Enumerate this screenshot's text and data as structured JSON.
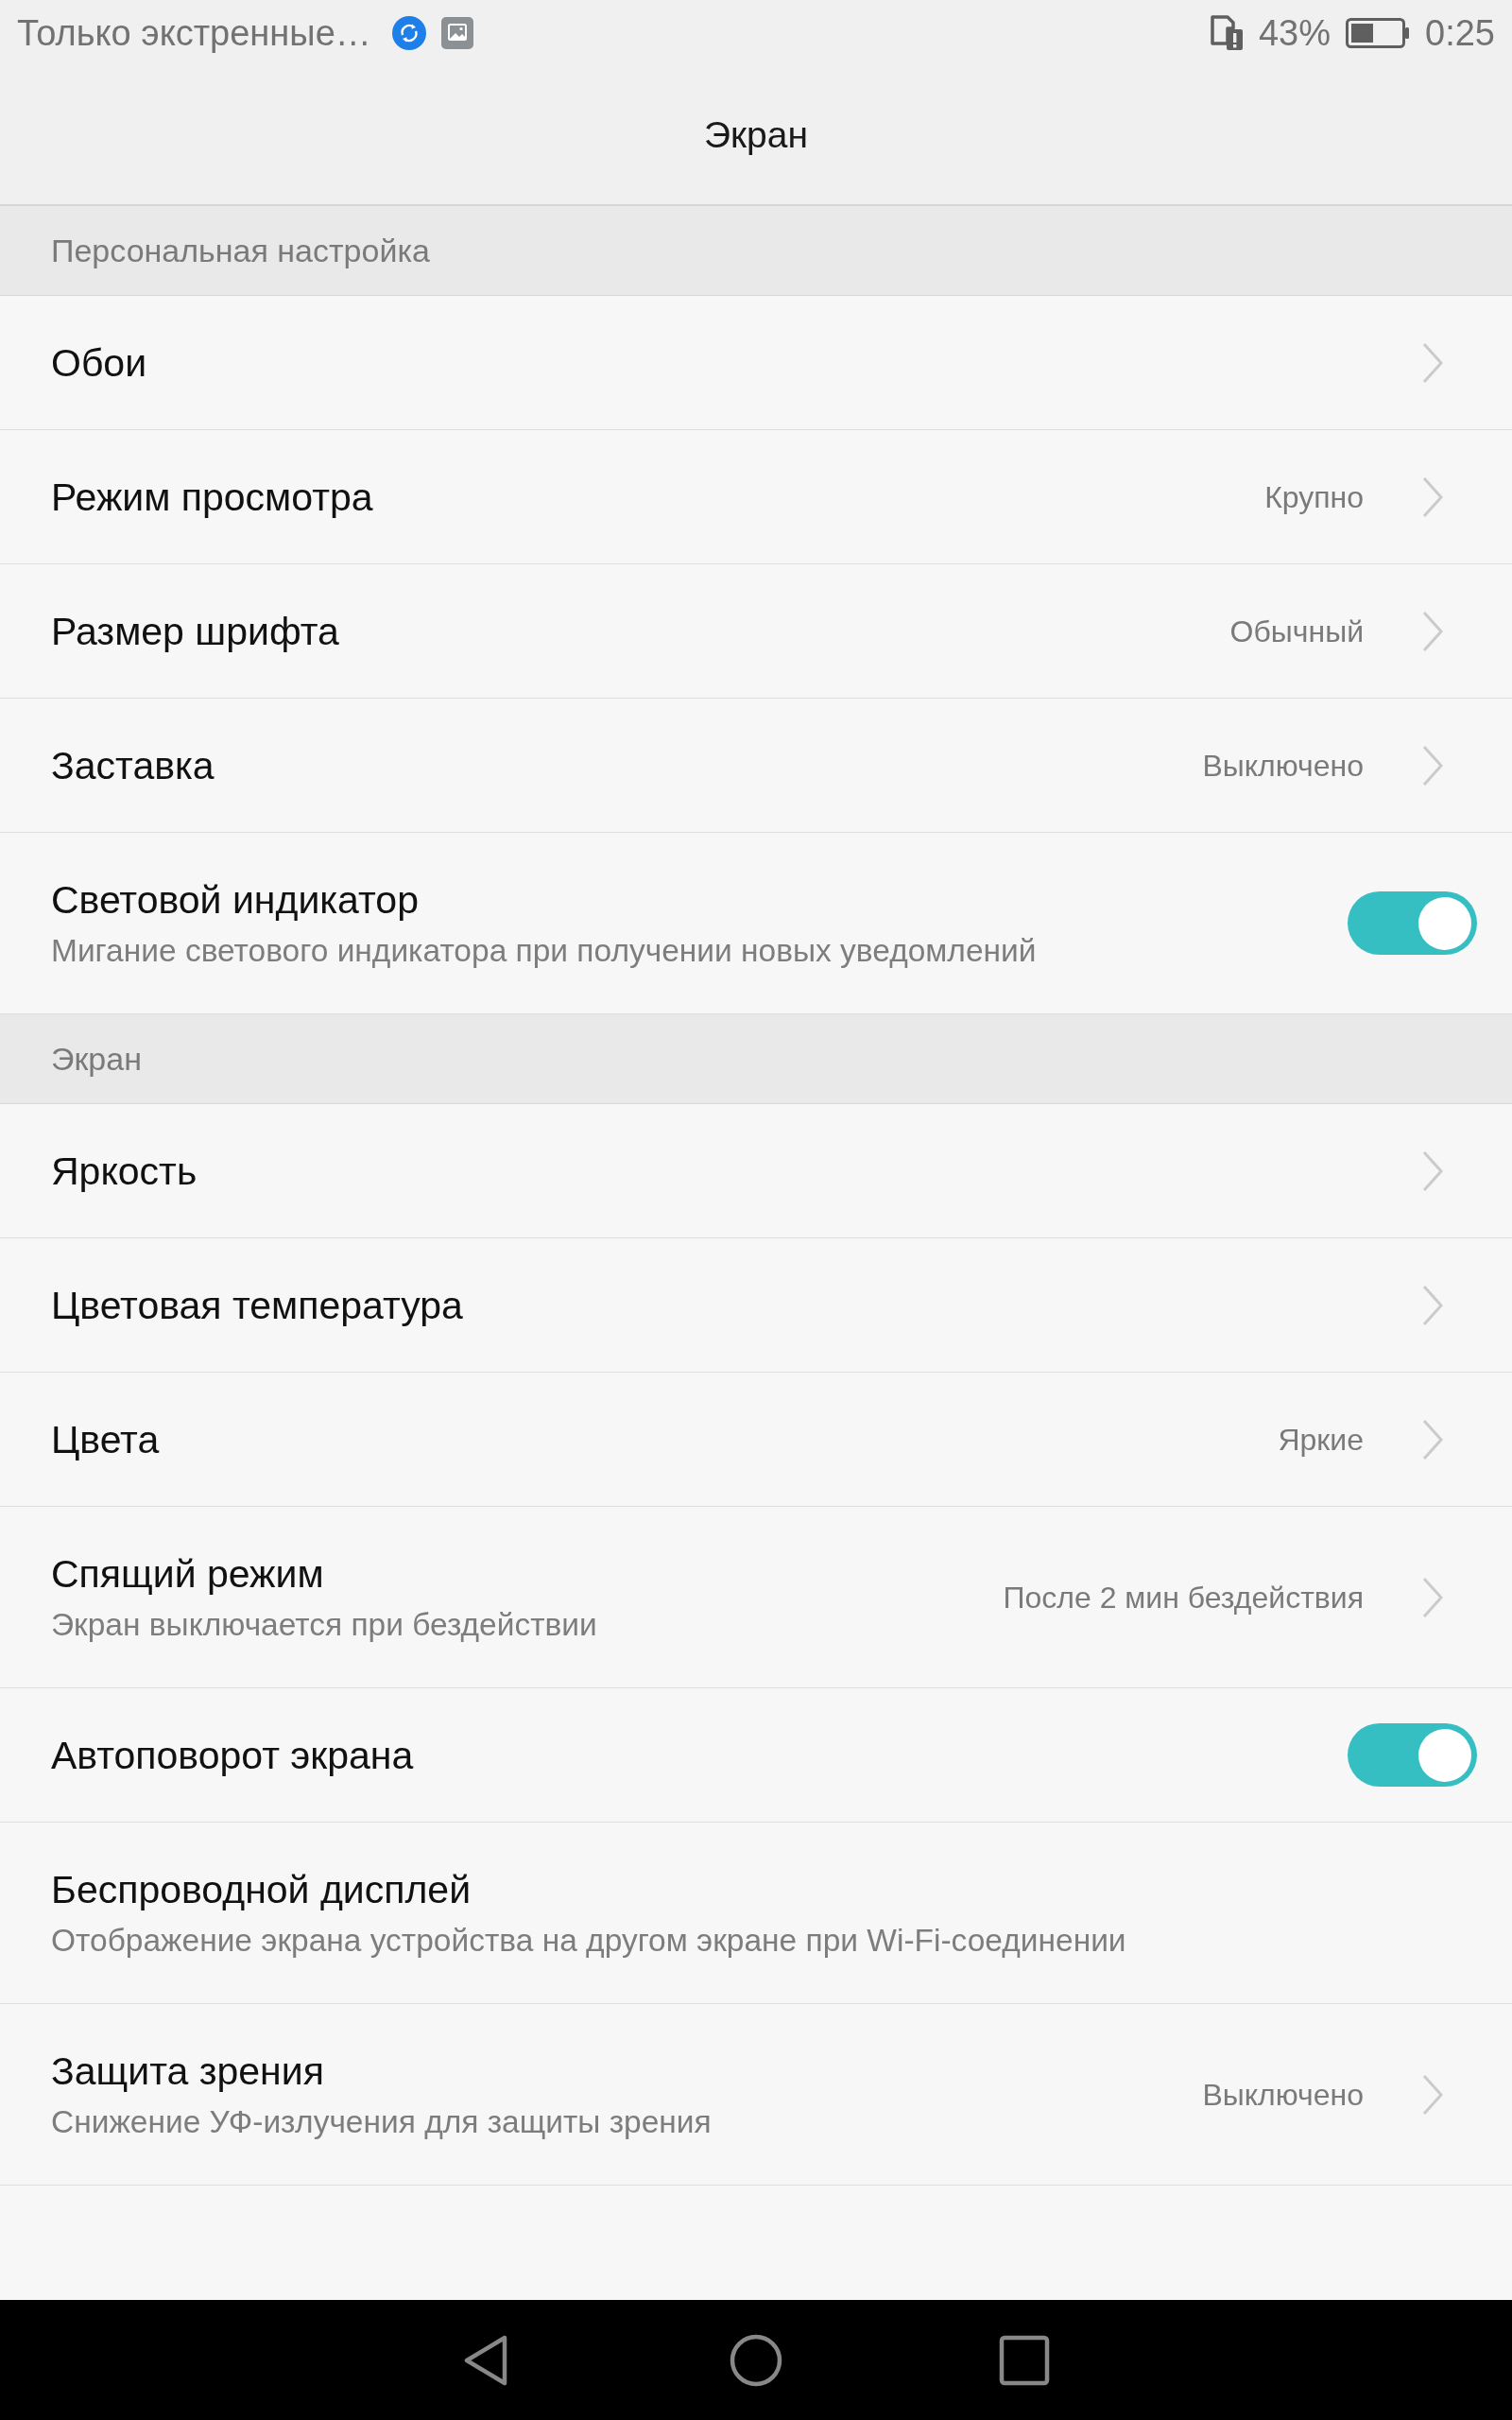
{
  "status_bar": {
    "notification": "Только экстренные…",
    "battery_percent": "43%",
    "time": "0:25"
  },
  "title": "Экран",
  "sections": [
    {
      "header": "Персональная настройка",
      "items": [
        {
          "kind": "link",
          "title": "Обои"
        },
        {
          "kind": "link",
          "title": "Режим просмотра",
          "value": "Крупно"
        },
        {
          "kind": "link",
          "title": "Размер шрифта",
          "value": "Обычный"
        },
        {
          "kind": "link",
          "title": "Заставка",
          "value": "Выключено"
        },
        {
          "kind": "toggle",
          "title": "Световой индикатор",
          "subtitle": "Мигание светового индикатора при получении новых уведомлений",
          "on": true
        }
      ]
    },
    {
      "header": "Экран",
      "items": [
        {
          "kind": "link",
          "title": "Яркость"
        },
        {
          "kind": "link",
          "title": "Цветовая температура"
        },
        {
          "kind": "link",
          "title": "Цвета",
          "value": "Яркие"
        },
        {
          "kind": "link",
          "title": "Спящий режим",
          "subtitle": "Экран выключается при бездействии",
          "value": "После 2 мин бездействия"
        },
        {
          "kind": "toggle",
          "title": "Автоповорот экрана",
          "on": true
        },
        {
          "kind": "plain",
          "title": "Беспроводной дисплей",
          "subtitle": "Отображение экрана устройства на другом экране при Wi-Fi-соединении"
        },
        {
          "kind": "link",
          "title": "Защита зрения",
          "subtitle": "Снижение УФ-излучения для защиты зрения",
          "value": "Выключено"
        }
      ]
    }
  ]
}
